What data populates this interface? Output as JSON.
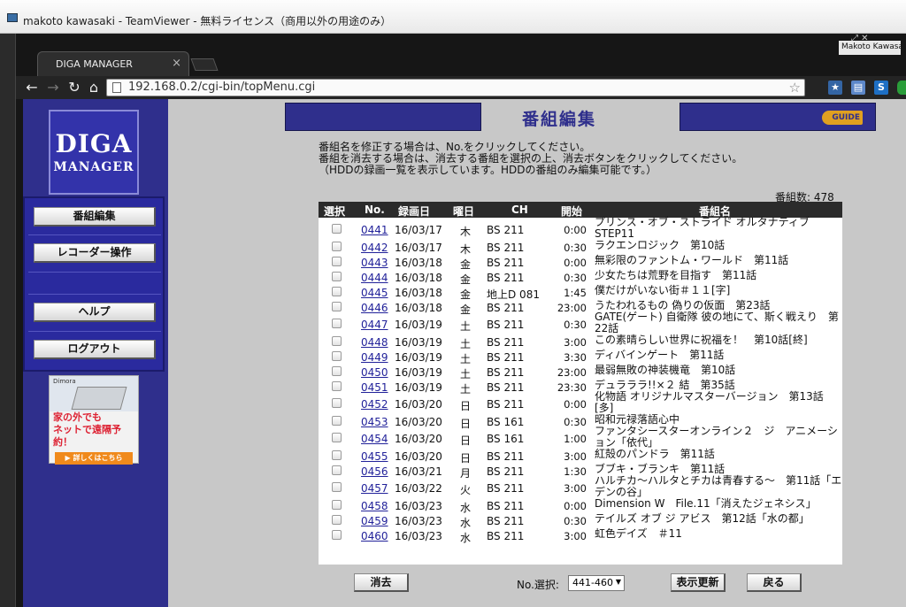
{
  "window": {
    "title": "makoto kawasaki - TeamViewer - 無料ライセンス（商用以外の用途のみ）"
  },
  "browser": {
    "tab_label": "DIGA MANAGER",
    "url": "192.168.0.2/cgi-bin/topMenu.cgi",
    "user_badge": "Makoto Kawasaki"
  },
  "sidebar": {
    "logo_line1": "DIGA",
    "logo_line2": "MANAGER",
    "menu": [
      "番組編集",
      "レコーダー操作",
      "ヘルプ",
      "ログアウト"
    ],
    "ad": {
      "brand": "Dimora",
      "line1": "家の外でも",
      "line2": "ネットで遠隔予約！",
      "button": "▶ 詳しくはこちら"
    }
  },
  "header": {
    "title": "番組編集",
    "logo": "GUIDE"
  },
  "instructions": [
    "番組名を修正する場合は、No.をクリックしてください。",
    "番組を消去する場合は、消去する番組を選択の上、消去ボタンをクリックしてください。",
    "（HDDの録画一覧を表示しています。HDDの番組のみ編集可能です。）"
  ],
  "count_text": "番組数: 478",
  "table": {
    "headers": [
      "選択",
      "No.",
      "録画日",
      "曜日",
      "CH",
      "開始",
      "番組名"
    ],
    "rows": [
      {
        "no": "0441",
        "date": "16/03/17",
        "dow": "木",
        "ch": "BS 211",
        "start": "0:00",
        "title": "プリンス・オブ・ストライド オルタナティブ　STEP11"
      },
      {
        "no": "0442",
        "date": "16/03/17",
        "dow": "木",
        "ch": "BS 211",
        "start": "0:30",
        "title": "ラクエンロジック　第10話"
      },
      {
        "no": "0443",
        "date": "16/03/18",
        "dow": "金",
        "ch": "BS 211",
        "start": "0:00",
        "title": "無彩限のファントム・ワールド　第11話"
      },
      {
        "no": "0444",
        "date": "16/03/18",
        "dow": "金",
        "ch": "BS 211",
        "start": "0:30",
        "title": "少女たちは荒野を目指す　第11話"
      },
      {
        "no": "0445",
        "date": "16/03/18",
        "dow": "金",
        "ch": "地上D 081",
        "start": "1:45",
        "title": "僕だけがいない街＃１１[字]"
      },
      {
        "no": "0446",
        "date": "16/03/18",
        "dow": "金",
        "ch": "BS 211",
        "start": "23:00",
        "title": "うたわれるもの 偽りの仮面　第23話"
      },
      {
        "no": "0447",
        "date": "16/03/19",
        "dow": "土",
        "ch": "BS 211",
        "start": "0:30",
        "title": "GATE(ゲート) 自衛隊 彼の地にて、斯く戦えり　第22話"
      },
      {
        "no": "0448",
        "date": "16/03/19",
        "dow": "土",
        "ch": "BS 211",
        "start": "3:00",
        "title": "この素晴らしい世界に祝福を！　第10話[終]"
      },
      {
        "no": "0449",
        "date": "16/03/19",
        "dow": "土",
        "ch": "BS 211",
        "start": "3:30",
        "title": "ディバインゲート　第11話"
      },
      {
        "no": "0450",
        "date": "16/03/19",
        "dow": "土",
        "ch": "BS 211",
        "start": "23:00",
        "title": "最弱無敗の神装機竜　第10話"
      },
      {
        "no": "0451",
        "date": "16/03/19",
        "dow": "土",
        "ch": "BS 211",
        "start": "23:30",
        "title": "デュラララ!!×２ 結　第35話"
      },
      {
        "no": "0452",
        "date": "16/03/20",
        "dow": "日",
        "ch": "BS 211",
        "start": "0:00",
        "title": "化物語 オリジナルマスターバージョン　第13話[多]"
      },
      {
        "no": "0453",
        "date": "16/03/20",
        "dow": "日",
        "ch": "BS 161",
        "start": "0:30",
        "title": "昭和元禄落語心中"
      },
      {
        "no": "0454",
        "date": "16/03/20",
        "dow": "日",
        "ch": "BS 161",
        "start": "1:00",
        "title": "ファンタシースターオンライン２　ジ　アニメーション「依代」"
      },
      {
        "no": "0455",
        "date": "16/03/20",
        "dow": "日",
        "ch": "BS 211",
        "start": "3:00",
        "title": "紅殻のパンドラ　第11話"
      },
      {
        "no": "0456",
        "date": "16/03/21",
        "dow": "月",
        "ch": "BS 211",
        "start": "1:30",
        "title": "ブブキ・ブランキ　第11話"
      },
      {
        "no": "0457",
        "date": "16/03/22",
        "dow": "火",
        "ch": "BS 211",
        "start": "3:00",
        "title": "ハルチカ～ハルタとチカは青春する～　第11話「エデンの谷」"
      },
      {
        "no": "0458",
        "date": "16/03/23",
        "dow": "水",
        "ch": "BS 211",
        "start": "0:00",
        "title": "Dimension W　File.11「消えたジェネシス」"
      },
      {
        "no": "0459",
        "date": "16/03/23",
        "dow": "水",
        "ch": "BS 211",
        "start": "0:30",
        "title": "テイルズ オブ ジ アビス　第12話「水の都」"
      },
      {
        "no": "0460",
        "date": "16/03/23",
        "dow": "水",
        "ch": "BS 211",
        "start": "3:00",
        "title": "虹色デイズ　＃11"
      }
    ]
  },
  "footer": {
    "delete_label": "消去",
    "select_label": "No.選択:",
    "select_value": "441-460",
    "refresh_label": "表示更新",
    "back_label": "戻る"
  }
}
